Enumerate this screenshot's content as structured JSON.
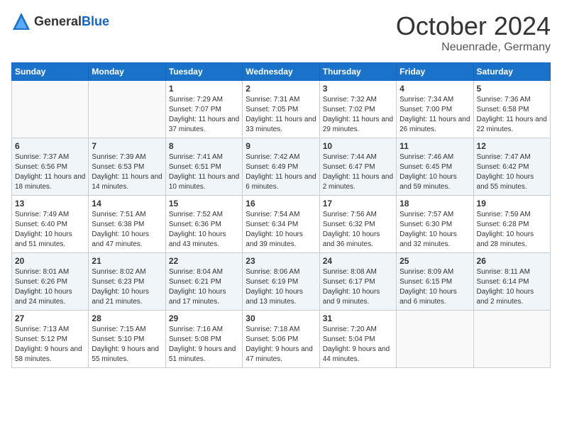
{
  "header": {
    "logo_general": "General",
    "logo_blue": "Blue",
    "month": "October 2024",
    "location": "Neuenrade, Germany"
  },
  "weekdays": [
    "Sunday",
    "Monday",
    "Tuesday",
    "Wednesday",
    "Thursday",
    "Friday",
    "Saturday"
  ],
  "weeks": [
    [
      {
        "day": "",
        "info": ""
      },
      {
        "day": "",
        "info": ""
      },
      {
        "day": "1",
        "info": "Sunrise: 7:29 AM\nSunset: 7:07 PM\nDaylight: 11 hours and 37 minutes."
      },
      {
        "day": "2",
        "info": "Sunrise: 7:31 AM\nSunset: 7:05 PM\nDaylight: 11 hours and 33 minutes."
      },
      {
        "day": "3",
        "info": "Sunrise: 7:32 AM\nSunset: 7:02 PM\nDaylight: 11 hours and 29 minutes."
      },
      {
        "day": "4",
        "info": "Sunrise: 7:34 AM\nSunset: 7:00 PM\nDaylight: 11 hours and 26 minutes."
      },
      {
        "day": "5",
        "info": "Sunrise: 7:36 AM\nSunset: 6:58 PM\nDaylight: 11 hours and 22 minutes."
      }
    ],
    [
      {
        "day": "6",
        "info": "Sunrise: 7:37 AM\nSunset: 6:56 PM\nDaylight: 11 hours and 18 minutes."
      },
      {
        "day": "7",
        "info": "Sunrise: 7:39 AM\nSunset: 6:53 PM\nDaylight: 11 hours and 14 minutes."
      },
      {
        "day": "8",
        "info": "Sunrise: 7:41 AM\nSunset: 6:51 PM\nDaylight: 11 hours and 10 minutes."
      },
      {
        "day": "9",
        "info": "Sunrise: 7:42 AM\nSunset: 6:49 PM\nDaylight: 11 hours and 6 minutes."
      },
      {
        "day": "10",
        "info": "Sunrise: 7:44 AM\nSunset: 6:47 PM\nDaylight: 11 hours and 2 minutes."
      },
      {
        "day": "11",
        "info": "Sunrise: 7:46 AM\nSunset: 6:45 PM\nDaylight: 10 hours and 59 minutes."
      },
      {
        "day": "12",
        "info": "Sunrise: 7:47 AM\nSunset: 6:42 PM\nDaylight: 10 hours and 55 minutes."
      }
    ],
    [
      {
        "day": "13",
        "info": "Sunrise: 7:49 AM\nSunset: 6:40 PM\nDaylight: 10 hours and 51 minutes."
      },
      {
        "day": "14",
        "info": "Sunrise: 7:51 AM\nSunset: 6:38 PM\nDaylight: 10 hours and 47 minutes."
      },
      {
        "day": "15",
        "info": "Sunrise: 7:52 AM\nSunset: 6:36 PM\nDaylight: 10 hours and 43 minutes."
      },
      {
        "day": "16",
        "info": "Sunrise: 7:54 AM\nSunset: 6:34 PM\nDaylight: 10 hours and 39 minutes."
      },
      {
        "day": "17",
        "info": "Sunrise: 7:56 AM\nSunset: 6:32 PM\nDaylight: 10 hours and 36 minutes."
      },
      {
        "day": "18",
        "info": "Sunrise: 7:57 AM\nSunset: 6:30 PM\nDaylight: 10 hours and 32 minutes."
      },
      {
        "day": "19",
        "info": "Sunrise: 7:59 AM\nSunset: 6:28 PM\nDaylight: 10 hours and 28 minutes."
      }
    ],
    [
      {
        "day": "20",
        "info": "Sunrise: 8:01 AM\nSunset: 6:26 PM\nDaylight: 10 hours and 24 minutes."
      },
      {
        "day": "21",
        "info": "Sunrise: 8:02 AM\nSunset: 6:23 PM\nDaylight: 10 hours and 21 minutes."
      },
      {
        "day": "22",
        "info": "Sunrise: 8:04 AM\nSunset: 6:21 PM\nDaylight: 10 hours and 17 minutes."
      },
      {
        "day": "23",
        "info": "Sunrise: 8:06 AM\nSunset: 6:19 PM\nDaylight: 10 hours and 13 minutes."
      },
      {
        "day": "24",
        "info": "Sunrise: 8:08 AM\nSunset: 6:17 PM\nDaylight: 10 hours and 9 minutes."
      },
      {
        "day": "25",
        "info": "Sunrise: 8:09 AM\nSunset: 6:15 PM\nDaylight: 10 hours and 6 minutes."
      },
      {
        "day": "26",
        "info": "Sunrise: 8:11 AM\nSunset: 6:14 PM\nDaylight: 10 hours and 2 minutes."
      }
    ],
    [
      {
        "day": "27",
        "info": "Sunrise: 7:13 AM\nSunset: 5:12 PM\nDaylight: 9 hours and 58 minutes."
      },
      {
        "day": "28",
        "info": "Sunrise: 7:15 AM\nSunset: 5:10 PM\nDaylight: 9 hours and 55 minutes."
      },
      {
        "day": "29",
        "info": "Sunrise: 7:16 AM\nSunset: 5:08 PM\nDaylight: 9 hours and 51 minutes."
      },
      {
        "day": "30",
        "info": "Sunrise: 7:18 AM\nSunset: 5:06 PM\nDaylight: 9 hours and 47 minutes."
      },
      {
        "day": "31",
        "info": "Sunrise: 7:20 AM\nSunset: 5:04 PM\nDaylight: 9 hours and 44 minutes."
      },
      {
        "day": "",
        "info": ""
      },
      {
        "day": "",
        "info": ""
      }
    ]
  ]
}
